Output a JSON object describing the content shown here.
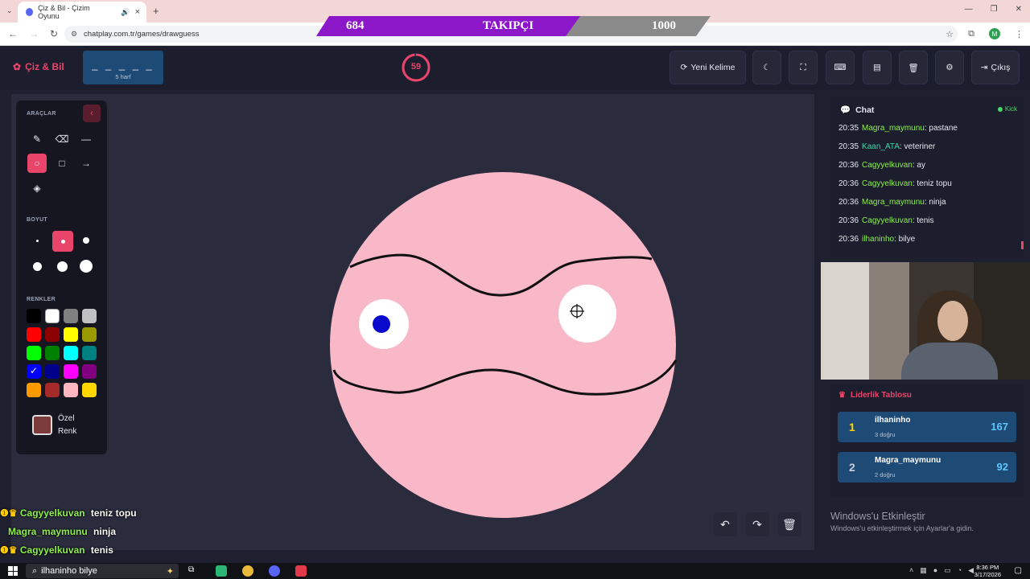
{
  "browser": {
    "tab_title": "Çiz & Bil - Çizim Oyunu",
    "url": "chatplay.com.tr/games/drawguess",
    "profile_initial": "M"
  },
  "follower_bar": {
    "current": "684",
    "label": "TAKIPÇI",
    "goal": "1000"
  },
  "app": {
    "logo": "Çiz & Bil",
    "word_hint": "_ _ _ _ _",
    "word_length": "5 harf",
    "timer": "59",
    "timer_fraction": 0.98,
    "new_word_label": "Yeni Kelime",
    "logout_label": "Çıkış"
  },
  "tools": {
    "section_tools": "ARAÇLAR",
    "section_size": "BOYUT",
    "section_colors": "RENKLER",
    "custom_color_label_1": "Özel",
    "custom_color_label_2": "Renk",
    "custom_color": "#7d3c3c",
    "colors": [
      "#000000",
      "#ffffff",
      "#808080",
      "#c0c0c0",
      "#ff0000",
      "#8b0000",
      "#ffff00",
      "#9a9a00",
      "#00ff00",
      "#008000",
      "#00ffff",
      "#008080",
      "#0000ff",
      "#00008b",
      "#ff00ff",
      "#800080",
      "#ff9900",
      "#a52a2a",
      "#ffb6c1",
      "#ffd700"
    ],
    "selected_color": "#0000ff"
  },
  "overlay_chat": [
    {
      "user": "Cagyyelkuvan",
      "text": "teniz topu"
    },
    {
      "user": "Magra_maymunu",
      "text": "ninja"
    },
    {
      "user": "Cagyyelkuvan",
      "text": "tenis"
    }
  ],
  "chat": {
    "title": "Chat",
    "platform": "Kick",
    "messages": [
      {
        "time": "20:35",
        "user": "Magra_maymunu",
        "text": ": pastane"
      },
      {
        "time": "20:35",
        "user": "Kaan_ATA",
        "text": ": veteriner"
      },
      {
        "time": "20:36",
        "user": "Cagyyelkuvan",
        "text": ": ay"
      },
      {
        "time": "20:36",
        "user": "Cagyyelkuvan",
        "text": ": teniz topu"
      },
      {
        "time": "20:36",
        "user": "Magra_maymunu",
        "text": ": ninja"
      },
      {
        "time": "20:36",
        "user": "Cagyyelkuvan",
        "text": ": tenis"
      },
      {
        "time": "20:36",
        "user": "ilhaninho",
        "text": ": bilye"
      }
    ]
  },
  "leaderboard": {
    "title": "Liderlik Tablosu",
    "rows": [
      {
        "rank": "1",
        "name": "ilhaninho",
        "sub": "3 doğru",
        "points": "167"
      },
      {
        "rank": "2",
        "name": "Magra_maymunu",
        "sub": "2 doğru",
        "points": "92"
      }
    ]
  },
  "windows": {
    "activate_title": "Windows'u Etkinleştir",
    "activate_sub": "Windows'u etkinleştirmek için Ayarlar'a gidin.",
    "search_text": "ilhaninho bilye",
    "time": "8:36 PM",
    "date": "3/17/2026"
  }
}
